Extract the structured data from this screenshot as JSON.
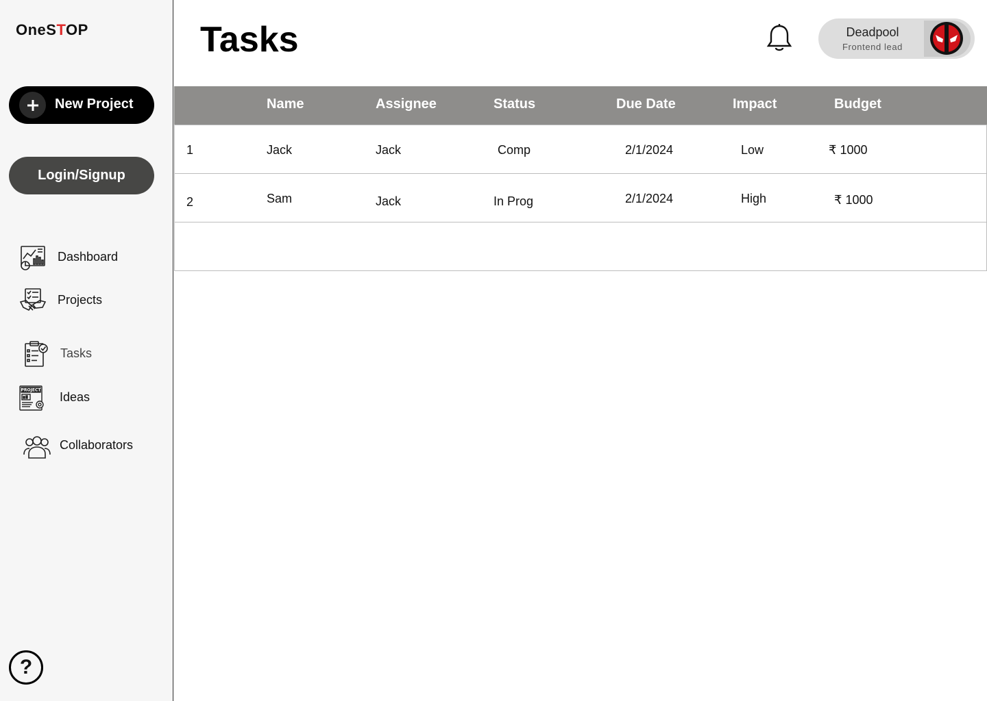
{
  "app": {
    "logo_prefix": "OneS",
    "logo_accent": "T",
    "logo_suffix": "OP",
    "accent_color": "#e02b2b"
  },
  "sidebar": {
    "new_project_label": "New Project",
    "login_label": "Login/Signup",
    "items": [
      {
        "label": "Dashboard",
        "icon": "dashboard-icon"
      },
      {
        "label": "Projects",
        "icon": "handshake-icon"
      },
      {
        "label": "Tasks",
        "icon": "clipboard-check-icon"
      },
      {
        "label": "Ideas",
        "icon": "project-board-icon"
      },
      {
        "label": "Collaborators",
        "icon": "people-icon"
      }
    ],
    "help_label": "?"
  },
  "header": {
    "title": "Tasks",
    "user_name": "Deadpool",
    "user_role": "Frontend lead"
  },
  "table": {
    "columns": [
      "",
      "Name",
      "Assignee",
      "Status",
      "Due Date",
      "Impact",
      "Budget"
    ],
    "rows": [
      {
        "id": "1",
        "name": "Jack",
        "assignee": "Jack",
        "status": "Comp",
        "due": "2/1/2024",
        "impact": "Low",
        "budget": "₹ 1000"
      },
      {
        "id": "2",
        "name": "Sam",
        "assignee": "Jack",
        "status": "In Prog",
        "due": "2/1/2024",
        "impact": "High",
        "budget": "₹ 1000"
      }
    ]
  }
}
